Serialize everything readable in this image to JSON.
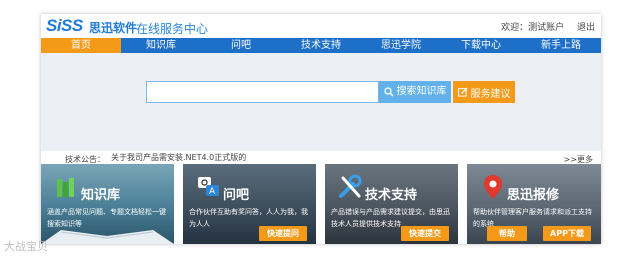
{
  "header": {
    "logo": "SiSS",
    "logo_cn": "思迅软件",
    "tagline": "在线服务中心",
    "welcome": "欢迎：测试账户",
    "logout": "退出"
  },
  "nav": {
    "items": [
      {
        "label": "首页"
      },
      {
        "label": "知识库"
      },
      {
        "label": "问吧"
      },
      {
        "label": "技术支持"
      },
      {
        "label": "思迅学院"
      },
      {
        "label": "下载中心"
      },
      {
        "label": "新手上路"
      }
    ]
  },
  "search": {
    "value": "",
    "button_label": "搜索知识库",
    "suggest_label": "服务建议"
  },
  "notice": {
    "label": "技术公告：",
    "text": "关于我司产品需安装.NET4.0正式版的",
    "more": ">>更多"
  },
  "cards": [
    {
      "title": "知识库",
      "desc": "涵盖产品常见问题、专题文档轻松一键搜索知识等"
    },
    {
      "title": "问吧",
      "desc": "合作伙伴互助有奖问答，人人为我，我为人人",
      "button": "快速提问"
    },
    {
      "title": "技术支持",
      "desc": "产品错误与产品需求建议提交，由思迅技术人员提供技术支持",
      "button": "快速提交"
    },
    {
      "title": "思迅报修",
      "desc": "帮助伙伴管理客户服务请求和派工支持的系统",
      "button": "帮助",
      "button2": "APP下载"
    }
  ],
  "watermark": "大战宝贝",
  "colors": {
    "nav_blue": "#1e6fc8",
    "active_orange": "#f59a18",
    "search_blue": "#63b1ea"
  }
}
